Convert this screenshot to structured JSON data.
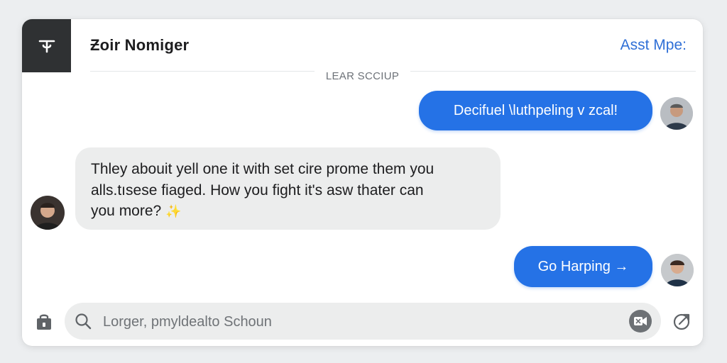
{
  "header": {
    "title": "Ƶoir Nomiger",
    "link_label": "Asst Mpe:"
  },
  "divider": {
    "label": "LEAR SCCIUP"
  },
  "messages": [
    {
      "direction": "outgoing",
      "text": "Decifuel \\luthpeling v zcal!"
    },
    {
      "direction": "incoming",
      "lines": [
        "Thley abouit yell one it with set cire prome them you",
        "alls.tısese fiaged. How you fight it's asw thater can",
        "you more? "
      ],
      "emoji": "✨"
    },
    {
      "direction": "outgoing",
      "text": "Go Harping →"
    }
  ],
  "composer": {
    "placeholder": "Lorger, pmyldealto Schoun"
  },
  "colors": {
    "accent": "#2572e6",
    "header_logo_bg": "#2f3133",
    "bubble_incoming": "#eceded"
  },
  "icons": {
    "logo": "logo-glyph-icon",
    "attach": "bag-icon",
    "search": "search-icon",
    "media": "video-icon",
    "send": "send-icon"
  }
}
